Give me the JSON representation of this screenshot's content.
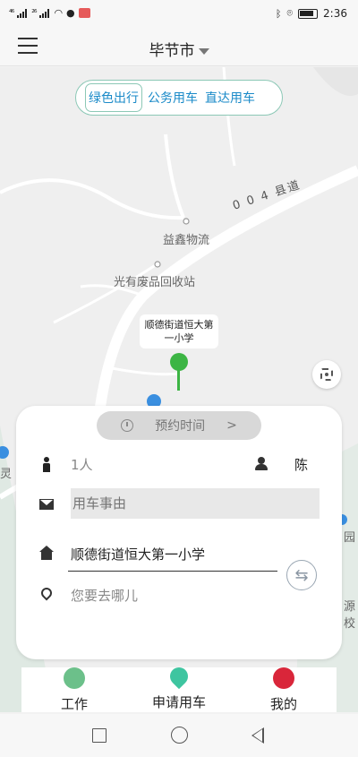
{
  "status_bar": {
    "signal_1": "⁴⁶",
    "signal_2": "²⁶",
    "time": "2:36"
  },
  "header": {
    "city": "毕节市"
  },
  "mode_tabs": [
    {
      "label": "绿色出行",
      "active": true
    },
    {
      "label": "公务用车",
      "active": false
    },
    {
      "label": "直达用车",
      "active": false
    }
  ],
  "map": {
    "road_label": "0 0 4 县道",
    "poi_1": "益鑫物流",
    "poi_2": "光有废品回收站",
    "pin_label": "顺德街道恒大第一小学",
    "edge_left": "灵",
    "edge_right_1": "园",
    "edge_right_2": "源",
    "edge_right_3": "校"
  },
  "panel": {
    "reserve_label": "预约时间",
    "reserve_arrow": ">",
    "passengers": "1人",
    "user_name": "陈",
    "reason_placeholder": "用车事由",
    "from_address": "顺德街道恒大第一小学",
    "to_placeholder": "您要去哪儿",
    "swap_symbol": "⇆"
  },
  "tabbar": {
    "tabs": [
      {
        "label": "工作",
        "icon": "document-icon",
        "color": "#6cc08a"
      },
      {
        "label": "申请用车",
        "icon": "location-pin-icon",
        "color": "#3ec5a0"
      },
      {
        "label": "我的",
        "icon": "user-icon",
        "color": "#d9263a"
      }
    ]
  },
  "colors": {
    "accent_blue": "#1a8ac8",
    "mode_border": "#8cc8b6",
    "pin_green": "#3cb544"
  }
}
